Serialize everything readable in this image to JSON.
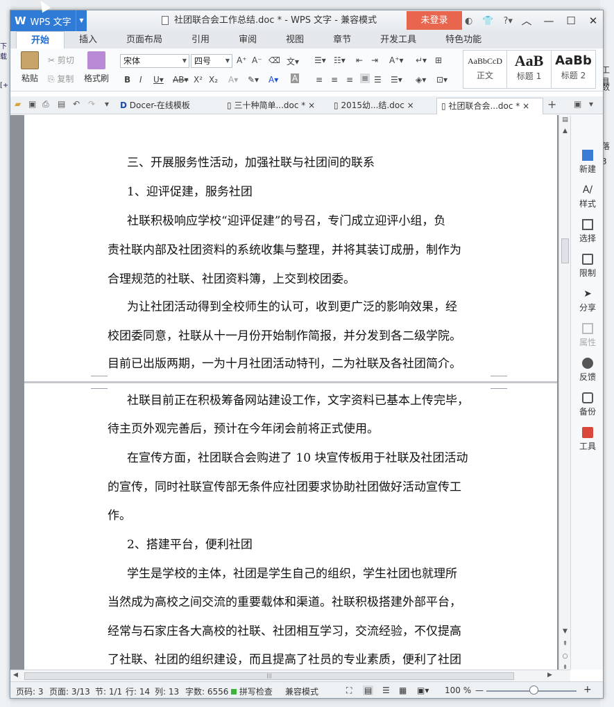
{
  "window": {
    "title": "社团联合会工作总结.doc * - WPS 文字 - 兼容模式",
    "app_menu": "WPS 文字",
    "login": "未登录"
  },
  "tabs": [
    "开始",
    "插入",
    "页面布局",
    "引用",
    "审阅",
    "视图",
    "章节",
    "开发工具",
    "特色功能"
  ],
  "ribbon": {
    "paste": "粘贴",
    "cut": "剪切",
    "copy": "复制",
    "format_painter": "格式刷",
    "font_name": "宋体",
    "font_size": "四号",
    "styles": [
      {
        "sample": "AaBbCcD",
        "label": "正文"
      },
      {
        "sample": "AaB",
        "label": "标题 1"
      },
      {
        "sample": "AaBb",
        "label": "标题 2"
      }
    ]
  },
  "doc_tabs": [
    {
      "label": "Docer-在线模板",
      "active": false
    },
    {
      "label": "三十种简单...doc *",
      "active": false
    },
    {
      "label": "2015幼...结.doc",
      "active": false
    },
    {
      "label": "社团联合会...doc *",
      "active": true
    }
  ],
  "document": {
    "page1": [
      "三、开展服务性活动，加强社联与社团间的联系",
      "1、迎评促建，服务社团",
      "社联积极响应学校“迎评促建”的号召，专门成立迎评小组，负",
      "责社联内部及社团资料的系统收集与整理，并将其装订成册，制作为",
      "合理规范的社联、社团资料簿，上交到校团委。",
      "为让社团活动得到全校师生的认可，收到更广泛的影响效果，经",
      "校团委同意，社联从十一月份开始制作简报，并分发到各二级学院。",
      "目前已出版两期，一为十月社团活动特刊，二为社联及各社团简介。"
    ],
    "page2": [
      "社联目前正在积极筹备网站建设工作，文字资料已基本上传完毕，",
      "待主页外观完善后，预计在今年闭会前将正式使用。",
      "在宣传方面，社团联合会购进了 10 块宣传板用于社联及社团活动",
      "的宣传，同时社联宣传部无条件应社团要求协助社团做好活动宣传工",
      "作。",
      "2、搭建平台，便利社团",
      "学生是学校的主体，社团是学生自己的组织，学生社团也就理所",
      "当然成为高校之间交流的重要载体和渠道。社联积极搭建外部平台，",
      "经常与石家庄各大高校的社联、社团相互学习，交流经验，不仅提高",
      "了社联、社团的组织建设，而且提高了社员的专业素质，便利了社团"
    ]
  },
  "task_pane": [
    {
      "label": "新建",
      "icon": "new-doc-icon",
      "disabled": false
    },
    {
      "label": "样式",
      "icon": "style-icon",
      "disabled": false
    },
    {
      "label": "选择",
      "icon": "select-icon",
      "disabled": false
    },
    {
      "label": "限制",
      "icon": "restrict-icon",
      "disabled": false
    },
    {
      "label": "分享",
      "icon": "share-icon",
      "disabled": false
    },
    {
      "label": "属性",
      "icon": "properties-icon",
      "disabled": true
    },
    {
      "label": "反馈",
      "icon": "feedback-icon",
      "disabled": false
    },
    {
      "label": "备份",
      "icon": "backup-icon",
      "disabled": false
    },
    {
      "label": "工具",
      "icon": "toolbox-icon",
      "disabled": false
    }
  ],
  "status": {
    "page_code": "页码: 3",
    "pages": "页面: 3/13",
    "section": "节: 1/1",
    "row": "行: 14",
    "col": "列: 13",
    "words": "字数: 6556",
    "spell": "拼写检查",
    "compat": "兼容模式",
    "zoom": "100 %"
  },
  "background": {
    "right_fragments": [
      "落",
      "3",
      "工具",
      "数"
    ],
    "left_fragments": [
      "下载",
      "[+"
    ]
  },
  "colors": {
    "accent": "#2f7bd5",
    "login": "#e8664e",
    "toolbox": "#d9463a"
  }
}
